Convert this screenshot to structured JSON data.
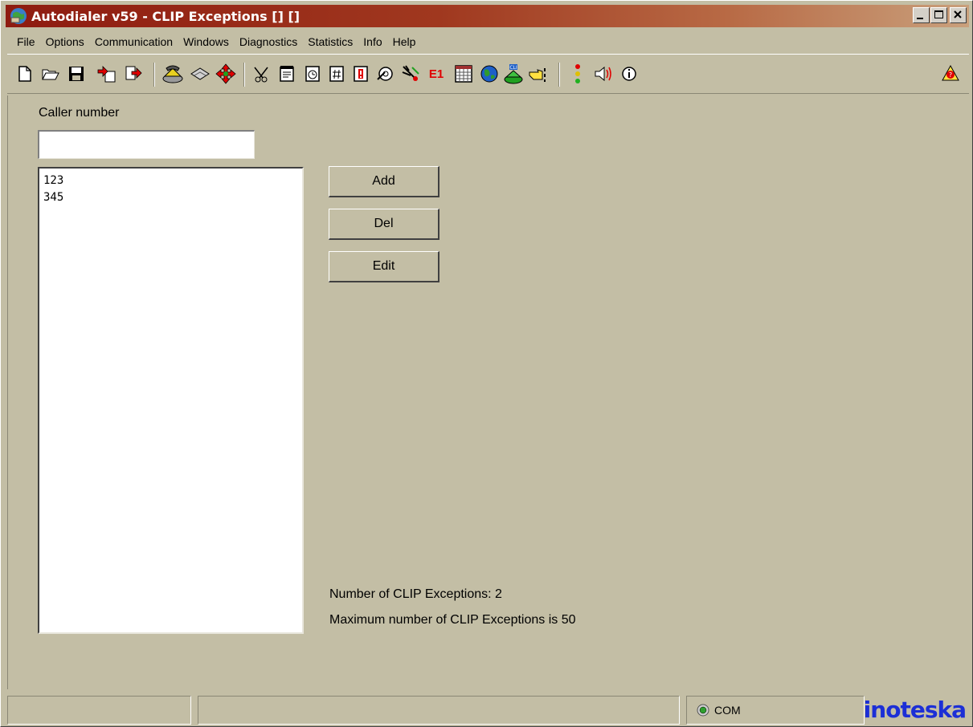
{
  "window": {
    "title": "Autodialer v59 - CLIP Exceptions [] []",
    "title_bar_color": "#8e1b10"
  },
  "menu": [
    {
      "label": "File"
    },
    {
      "label": "Options"
    },
    {
      "label": "Communication"
    },
    {
      "label": "Windows"
    },
    {
      "label": "Diagnostics"
    },
    {
      "label": "Statistics"
    },
    {
      "label": "Info"
    },
    {
      "label": "Help"
    }
  ],
  "toolbar": {
    "icons": [
      "new-document-icon",
      "open-folder-icon",
      "save-disk-icon",
      "import-icon",
      "export-icon",
      "phone-icon",
      "chip-icon",
      "move-arrows-icon",
      "scissors-icon",
      "notepad-icon",
      "timer-icon",
      "hash-icon",
      "alert-icon",
      "settings-icon",
      "wiring-icon",
      "calendar-icon",
      "globe-icon",
      "cli-phone-icon",
      "pointer-icon",
      "traffic-light-icon",
      "speaker-icon",
      "info-icon",
      "help-icon"
    ],
    "e1_label": "E1",
    "cli_label": "CLI"
  },
  "form": {
    "caller_label": "Caller number",
    "caller_value": "",
    "numbers": [
      "123",
      "345"
    ],
    "add_label": "Add",
    "del_label": "Del",
    "edit_label": "Edit",
    "count_text": "Number of CLIP Exceptions:  2",
    "max_text": "Maximum number of CLIP Exceptions is  50"
  },
  "status": {
    "com_label": "COM",
    "com_led_color": "#2e9f2e",
    "logo": "inoteska",
    "logo_color": "#1c2fd6"
  }
}
